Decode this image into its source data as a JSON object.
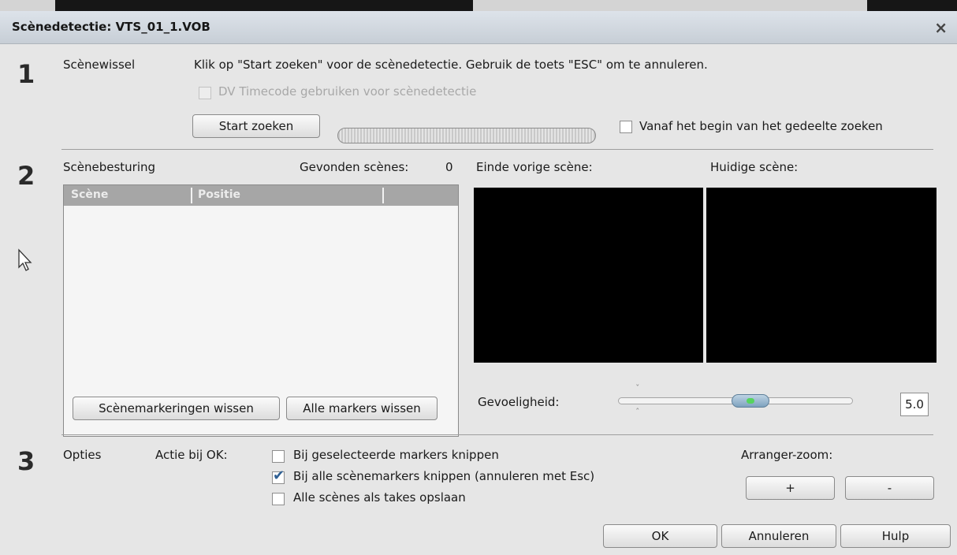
{
  "window": {
    "title": "Scènedetectie: VTS_01_1.VOB",
    "close_glyph": "×"
  },
  "section1": {
    "number": "1",
    "heading": "Scènewissel",
    "instruction": "Klik op \"Start zoeken\" voor de scènedetectie. Gebruik de toets \"ESC\" om te annuleren.",
    "dv_timecode_label": "DV Timecode gebruiken voor scènedetectie",
    "dv_timecode_checked": false,
    "dv_timecode_enabled": false,
    "start_button": "Start zoeken",
    "search_from_start_label": "Vanaf het begin van het gedeelte zoeken",
    "search_from_start_checked": false
  },
  "section2": {
    "number": "2",
    "heading": "Scènebesturing",
    "found_label": "Gevonden scènes:",
    "found_count": "0",
    "table_columns": [
      "Scène",
      "Positie"
    ],
    "table_rows": [],
    "prev_scene_label": "Einde vorige scène:",
    "current_scene_label": "Huidige scène:",
    "clear_scene_markers_button": "Scènemarkeringen wissen",
    "clear_all_markers_button": "Alle markers wissen",
    "sensitivity_label": "Gevoeligheid:",
    "sensitivity_value": "5.0"
  },
  "section3": {
    "number": "3",
    "heading": "Opties",
    "action_label": "Actie bij OK:",
    "options": [
      {
        "label": "Bij geselecteerde markers knippen",
        "checked": false
      },
      {
        "label": "Bij alle scènemarkers knippen (annuleren met Esc)",
        "checked": true
      },
      {
        "label": "Alle scènes als takes opslaan",
        "checked": false
      }
    ],
    "zoom_label": "Arranger-zoom:",
    "zoom_in": "+",
    "zoom_out": "-"
  },
  "footer": {
    "ok": "OK",
    "cancel": "Annuleren",
    "help": "Hulp"
  },
  "colors": {
    "title_bar": "#c7ced6",
    "dialog_bg": "#e6e6e6",
    "check_mark": "#2f5f93",
    "slider_thumb": "#7ea2bf",
    "slider_dot": "#56d35e"
  }
}
